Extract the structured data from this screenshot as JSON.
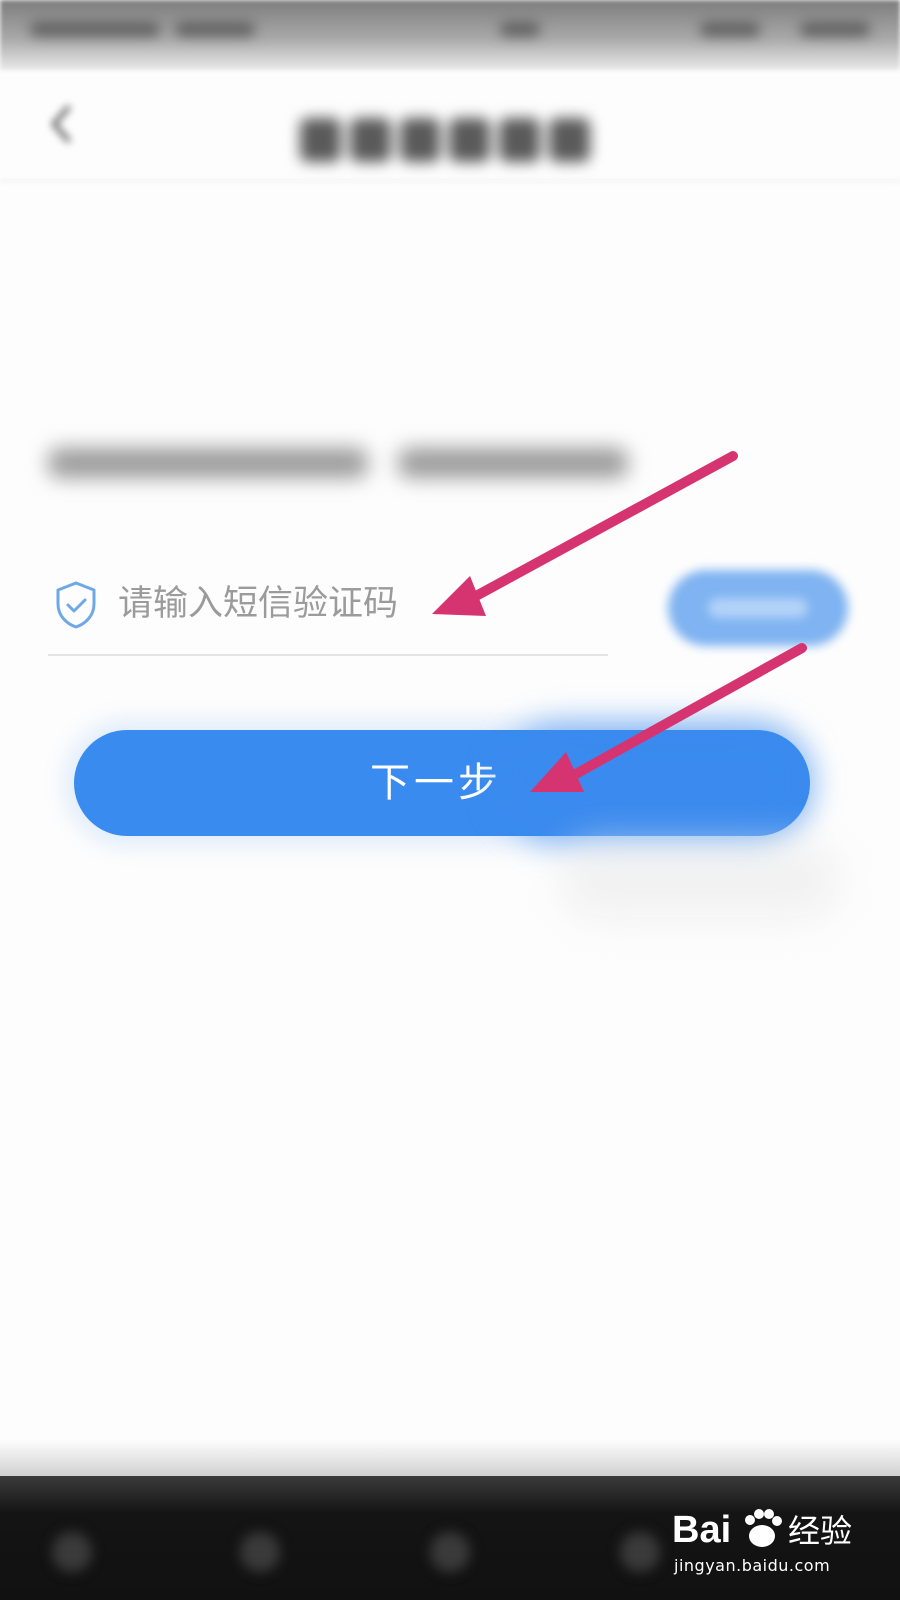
{
  "status_bar": {},
  "header": {
    "title_blurred": true
  },
  "sms_verification": {
    "code_input": {
      "value": "",
      "placeholder": "请输入短信验证码"
    },
    "get_code_button_blurred": true
  },
  "actions": {
    "next_label": "下一步"
  },
  "annotations": {
    "arrow_color": "#d63470"
  },
  "watermark": {
    "brand": "Bai 经验",
    "url": "jingyan.baidu.com"
  },
  "colors": {
    "primary": "#3a8bef",
    "placeholder": "#9b9b9b",
    "shield": "#6ea8e8"
  }
}
